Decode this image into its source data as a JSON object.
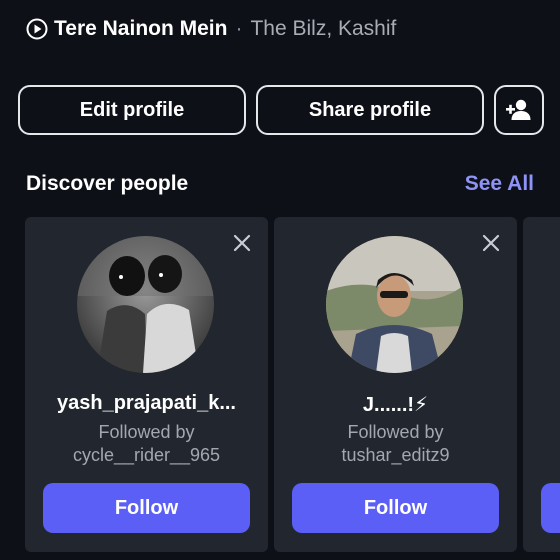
{
  "music": {
    "song": "Tere Nainon Mein",
    "separator": "·",
    "artist": "The Bilz, Kashif",
    "icon": "play-circle-icon"
  },
  "profile_buttons": {
    "edit_label": "Edit profile",
    "share_label": "Share profile",
    "add_icon": "add-person-icon"
  },
  "discover": {
    "title": "Discover people",
    "see_all": "See All",
    "cards": [
      {
        "name": "yash_prajapati_k...",
        "followed_by_label": "Followed by",
        "followed_by_user": "cycle__rider__965",
        "follow_label": "Follow",
        "close_icon": "close-icon",
        "avatar": "avatar-photo"
      },
      {
        "name": "J......!⚡",
        "followed_by_label": "Followed by",
        "followed_by_user": "tushar_editz9",
        "follow_label": "Follow",
        "close_icon": "close-icon",
        "avatar": "avatar-photo"
      }
    ]
  },
  "colors": {
    "background": "#0d1017",
    "card": "#22262e",
    "accent": "#5b5ff5",
    "link": "#8e93f5"
  }
}
